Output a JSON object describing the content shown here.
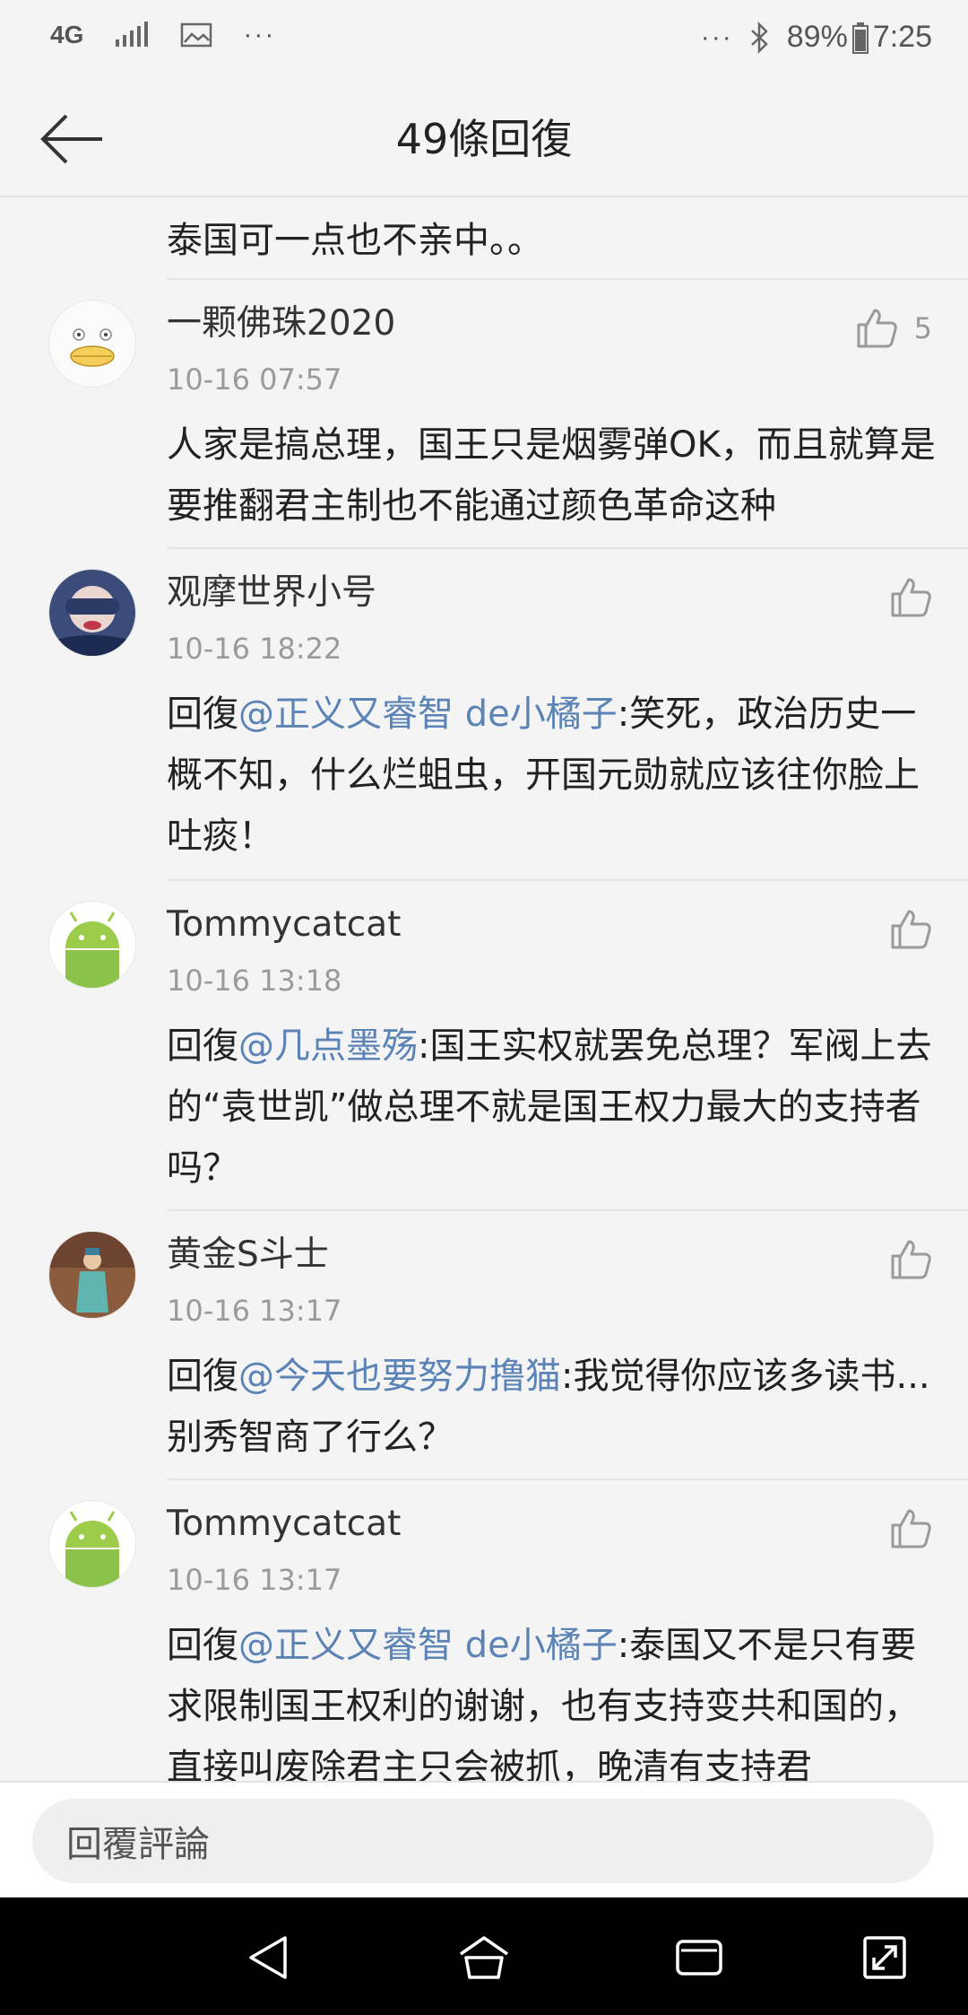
{
  "status_bar": {
    "network": "4G",
    "more": "···",
    "right_more": "···",
    "battery": "89%",
    "time": "7:25"
  },
  "header": {
    "title": "49條回復"
  },
  "partial_comment": {
    "text": "泰国可一点也不亲中。。"
  },
  "comments": [
    {
      "username": "一颗佛珠2020",
      "timestamp": "10-16 07:57",
      "like_count": "5",
      "text": "人家是搞总理，国王只是烟雾弹OK，而且就算是要推翻君主制也不能通过颜色革命这种"
    },
    {
      "username": "观摩世界小号",
      "timestamp": "10-16 18:22",
      "reply_prefix": "回復",
      "mention": "@正义又睿智 de小橘子",
      "text": ":笑死，政治历史一概不知，什么烂蛆虫，开国元勋就应该往你脸上吐痰！"
    },
    {
      "username": "Tommycatcat",
      "timestamp": "10-16 13:18",
      "reply_prefix": "回復",
      "mention": "@几点墨殇",
      "text": ":国王实权就罢免总理？军阀上去的“袁世凯”做总理不就是国王权力最大的支持者吗？"
    },
    {
      "username": "黄金S斗士",
      "timestamp": "10-16 13:17",
      "reply_prefix": "回復",
      "mention": "@今天也要努力撸猫",
      "text": ":我觉得你应该多读书...别秀智商了行么？"
    },
    {
      "username": "Tommycatcat",
      "timestamp": "10-16 13:17",
      "reply_prefix": "回復",
      "mention": "@正义又睿智 de小橘子",
      "text": ":泰国又不是只有要求限制国王权利的谢谢，也有支持变共和国的，直接叫废除君主只会被抓，晚清有支持君"
    }
  ],
  "reply_bar": {
    "placeholder": "回覆評論"
  },
  "colors": {
    "mention": "#5b83b5",
    "background": "#f4f4f4",
    "nav_bar": "#000000"
  }
}
